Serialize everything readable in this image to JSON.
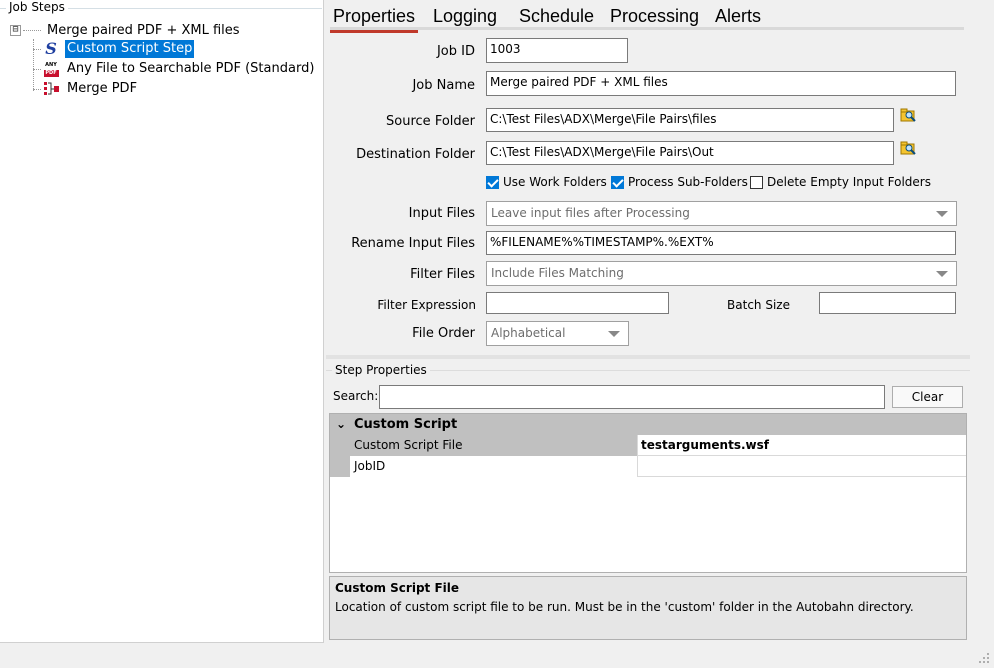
{
  "left_panel": {
    "group_title": "Job Steps",
    "root_expander": "⊟",
    "root_label": "Merge paired PDF + XML files",
    "steps": [
      {
        "label": "Custom Script Step",
        "icon": "script-icon",
        "selected": true
      },
      {
        "label": "Any File to Searchable PDF (Standard)",
        "icon": "anypdf-icon",
        "selected": false
      },
      {
        "label": "Merge PDF",
        "icon": "merge-pdf-icon",
        "selected": false
      }
    ],
    "anypdf_icon_top": "ANY",
    "anypdf_icon_bottom": "PDF",
    "script_icon_glyph": "S"
  },
  "tabs": [
    "Properties",
    "Logging",
    "Schedule",
    "Processing",
    "Alerts"
  ],
  "form": {
    "job_id_label": "Job ID",
    "job_id": "1003",
    "job_name_label": "Job Name",
    "job_name": "Merge paired PDF + XML files",
    "source_folder_label": "Source Folder",
    "source_folder": "C:\\Test Files\\ADX\\Merge\\File Pairs\\files",
    "destination_folder_label": "Destination Folder",
    "destination_folder": "C:\\Test Files\\ADX\\Merge\\File Pairs\\Out",
    "use_work_folders_label": "Use Work Folders",
    "use_work_folders": true,
    "process_sub_folders_label": "Process Sub-Folders",
    "process_sub_folders": true,
    "delete_empty_input_folders_label": "Delete Empty Input Folders",
    "delete_empty_input_folders": false,
    "input_files_label": "Input Files",
    "input_files": "Leave input files after Processing",
    "rename_input_files_label": "Rename Input Files",
    "rename_input_files": "%FILENAME%%TIMESTAMP%.%EXT%",
    "filter_files_label": "Filter Files",
    "filter_files": "Include Files Matching",
    "filter_expression_label": "Filter Expression",
    "filter_expression": "",
    "batch_size_label": "Batch Size",
    "batch_size": "",
    "file_order_label": "File Order",
    "file_order": "Alphabetical"
  },
  "step_properties": {
    "title": "Step Properties",
    "search_label": "Search:",
    "search_value": "",
    "clear_label": "Clear",
    "category_chevron": "⌄",
    "category": "Custom Script",
    "rows": [
      {
        "key": "Custom Script File",
        "value": "testarguments.wsf"
      },
      {
        "key": "JobID",
        "value": ""
      }
    ],
    "description_title": "Custom Script File",
    "description": "Location of custom script file to be run. Must be in the 'custom' folder in the Autobahn directory."
  },
  "colors": {
    "selection": "#0078d7",
    "tab_underline": "#c0392b",
    "pdf_red": "#c8102e"
  }
}
